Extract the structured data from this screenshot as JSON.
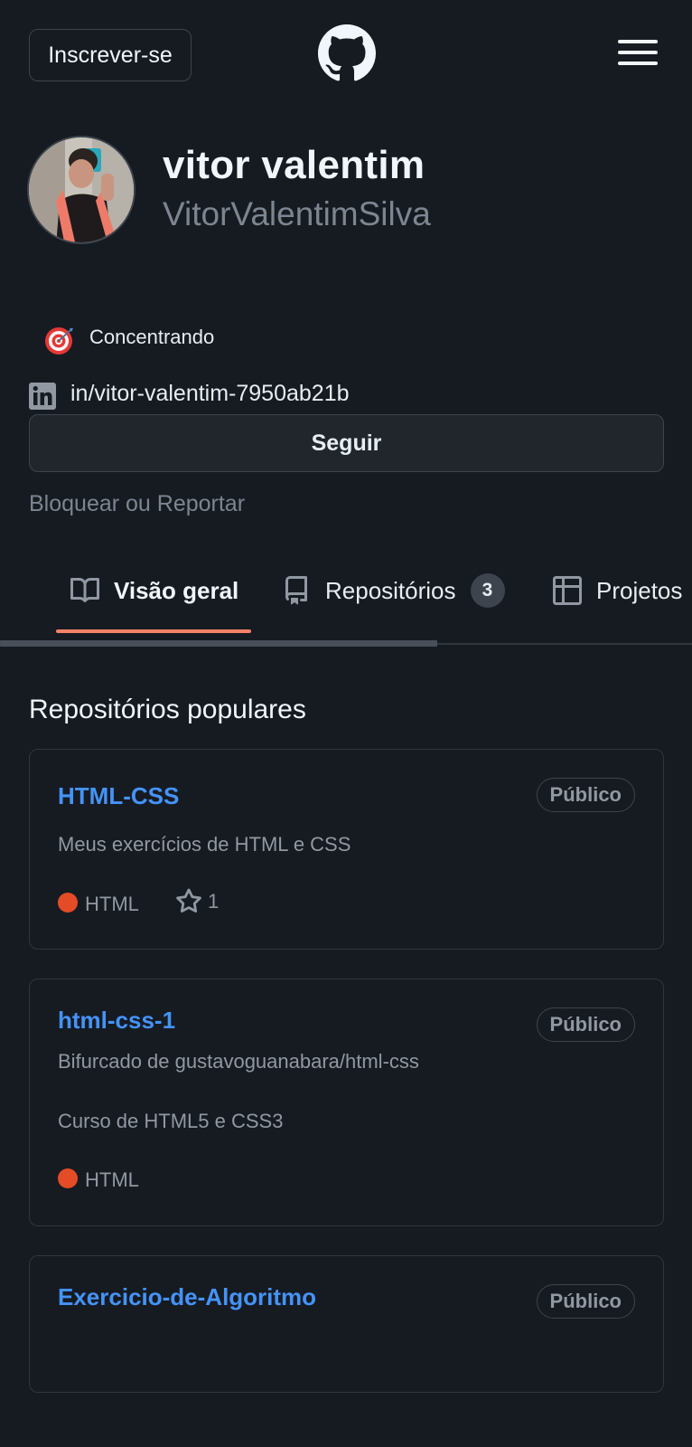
{
  "header": {
    "signup_label": "Inscrever-se",
    "logo_icon": "github-mark-icon",
    "menu_icon": "hamburger-menu-icon"
  },
  "profile": {
    "display_name": "vitor valentim",
    "username": "VitorValentimSilva",
    "status_icon": "direct-hit-emoji-icon",
    "status_text": "Concentrando",
    "linkedin_icon": "linkedin-icon",
    "linkedin": "in/vitor-valentim-7950ab21b",
    "follow_label": "Seguir",
    "block_label": "Bloquear ou Reportar"
  },
  "tabs": [
    {
      "label": "Visão geral",
      "icon": "book-icon",
      "active": true
    },
    {
      "label": "Repositórios",
      "icon": "repo-icon",
      "count": "3"
    },
    {
      "label": "Projetos",
      "icon": "table-icon"
    }
  ],
  "popular": {
    "title": "Repositórios populares",
    "repos": [
      {
        "name": "HTML-CSS",
        "visibility": "Público",
        "description": "Meus exercícios de HTML e CSS",
        "language": "HTML",
        "language_color": "#e34c26",
        "stars": "1"
      },
      {
        "name": "html-css-1",
        "visibility": "Público",
        "forked_from": "Bifurcado de gustavoguanabara/html-css",
        "description": "Curso de HTML5 e CSS3",
        "language": "HTML",
        "language_color": "#e34c26"
      },
      {
        "name": "Exercicio-de-Algoritmo",
        "visibility": "Público"
      }
    ]
  },
  "colors": {
    "background": "#161b22",
    "link": "#4493f8",
    "tab_underline": "#f78166",
    "muted_text": "#9198a1",
    "border": "#30363d"
  }
}
